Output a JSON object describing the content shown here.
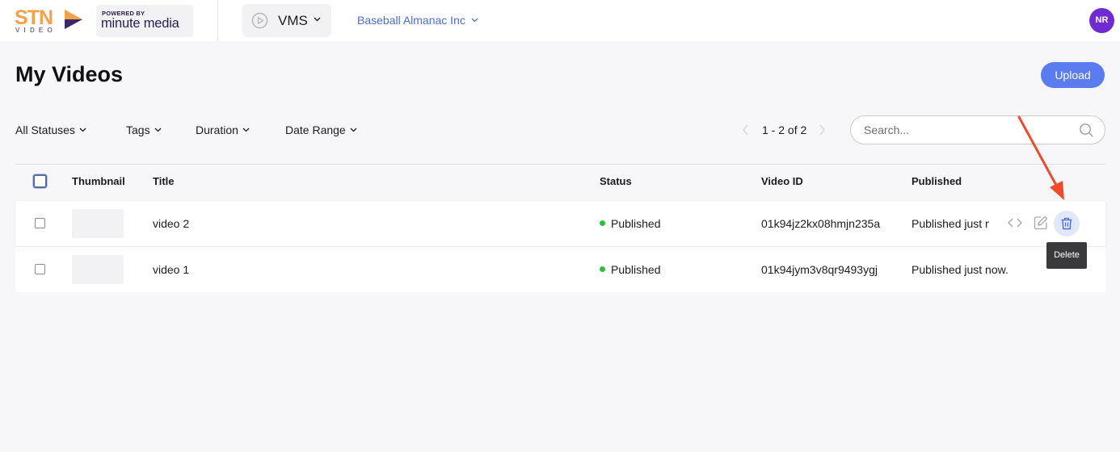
{
  "header": {
    "logo_text": "STN",
    "logo_subtext": "VIDEO",
    "powered_by": "POWERED BY",
    "powered_brand": "minute media",
    "product": "VMS",
    "organization": "Baseball Almanac Inc",
    "avatar_initials": "NR"
  },
  "page": {
    "title": "My Videos",
    "upload_label": "Upload"
  },
  "filters": {
    "statuses": "All Statuses",
    "tags": "Tags",
    "duration": "Duration",
    "date_range": "Date Range"
  },
  "pager": {
    "text": "1 - 2 of 2"
  },
  "search": {
    "placeholder": "Search..."
  },
  "table": {
    "headers": [
      "Thumbnail",
      "Title",
      "Status",
      "Video ID",
      "Published"
    ],
    "rows": [
      {
        "title": "video 2",
        "status": "Published",
        "video_id": "01k94jz2kx08hmjn235a",
        "published": "Published just now."
      },
      {
        "title": "video 1",
        "status": "Published",
        "video_id": "01k94jym3v8qr9493ygj",
        "published": "Published just now."
      }
    ]
  },
  "tooltip": {
    "text": "Delete"
  },
  "colors": {
    "accent": "#5a7cf0",
    "link": "#4d6bd9",
    "avatar": "#6f2ad1",
    "status_published": "#2cbf3d",
    "annotation_arrow": "#ef4a2b",
    "logo_orange": "#f5a04a"
  },
  "icons": {
    "logo": "stn-play-logo-icon",
    "product": "play-circle-icon",
    "search": "search-icon",
    "embed": "code-icon",
    "edit": "edit-icon",
    "delete": "trash-icon"
  }
}
